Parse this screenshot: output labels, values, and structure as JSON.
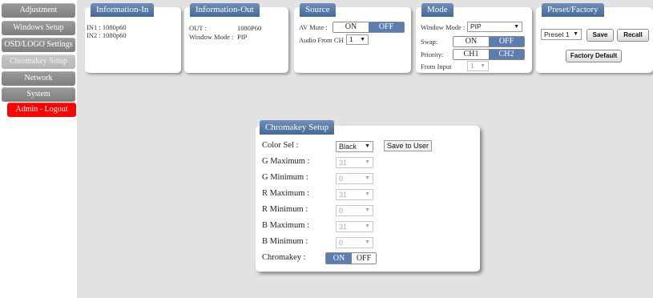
{
  "sidebar": {
    "items": [
      {
        "label": "Adjustment"
      },
      {
        "label": "Windows Setup"
      },
      {
        "label": "OSD/LOGO Settings"
      },
      {
        "label": "Chromakey Setup"
      },
      {
        "label": "Network"
      },
      {
        "label": "System"
      },
      {
        "label": "Admin - Logout"
      }
    ],
    "active": "Chromakey Setup"
  },
  "info_in": {
    "title": "Information-In",
    "in1": "IN1 : 1080p60",
    "in2": "IN2 : 1080p60"
  },
  "info_out": {
    "title": "Information-Out",
    "out_label": "OUT :",
    "out_value": "1080P60",
    "window_mode_label": "Window Mode :",
    "window_mode_value": "PIP"
  },
  "source": {
    "title": "Source",
    "av_mute_label": "AV Mute :",
    "on": "ON",
    "off": "OFF",
    "audio_label": "Audio From CH",
    "audio_value": "1"
  },
  "mode": {
    "title": "Mode",
    "window_mode_label": "Window Mode :",
    "window_mode_value": "PIP",
    "swap_label": "Swap:",
    "swap_on": "ON",
    "swap_off": "OFF",
    "priority_label": "Priority:",
    "ch1": "CH1",
    "ch2": "CH2",
    "from_input_label": "From Input",
    "from_input_value": "1"
  },
  "preset": {
    "title": "Preset/Factory",
    "select_value": "Preset 1",
    "save": "Save",
    "recall": "Recall",
    "factory_default": "Factory Default"
  },
  "chromakey": {
    "title": "Chromakey Setup",
    "save_to_user": "Save to User",
    "rows": [
      {
        "label": "Color Sel :",
        "value": "Black",
        "enabled": true
      },
      {
        "label": "G Maximum :",
        "value": "31",
        "enabled": false
      },
      {
        "label": "G Minimum :",
        "value": "0",
        "enabled": false
      },
      {
        "label": "R Maximum :",
        "value": "31",
        "enabled": false
      },
      {
        "label": "R Minimum :",
        "value": "0",
        "enabled": false
      },
      {
        "label": "B Maximum :",
        "value": "31",
        "enabled": false
      },
      {
        "label": "B Minimum :",
        "value": "0",
        "enabled": false
      }
    ],
    "chromakey_label": "Chromakey :",
    "on": "ON",
    "off": "OFF"
  },
  "colors": {
    "accent": "#5b7db0",
    "title_bar": "#46699a",
    "logout": "#ff0000",
    "background": "#e2e2e2"
  }
}
